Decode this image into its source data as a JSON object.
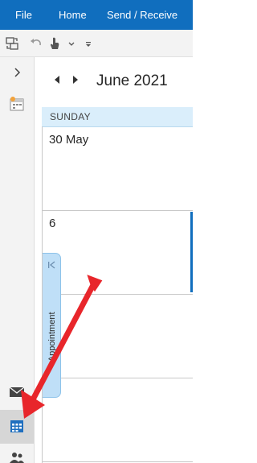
{
  "ribbon": {
    "tabs": [
      {
        "label": "File"
      },
      {
        "label": "Home"
      },
      {
        "label": "Send / Receive"
      }
    ]
  },
  "quick_access": {
    "icons": [
      "send-receive-all-icon",
      "undo-icon",
      "touch-mouse-mode-icon",
      "dropdown-caret-icon",
      "customize-toolbar-icon"
    ]
  },
  "left_nav": {
    "icons": [
      "expand-chevron-icon",
      "todo-calendar-icon",
      "mail-icon",
      "calendar-icon",
      "people-icon"
    ],
    "selected": "calendar"
  },
  "calendar": {
    "month_title": "June 2021",
    "day_header": "SUNDAY",
    "cells": [
      "30 May",
      "6"
    ],
    "previous_appointment_label": "Previous Appointment"
  },
  "colors": {
    "ribbon": "#106ebe",
    "day_header": "#daeefb",
    "prev_appointment_tab": "#bfdff7",
    "annotation_arrow": "#e8262b"
  }
}
